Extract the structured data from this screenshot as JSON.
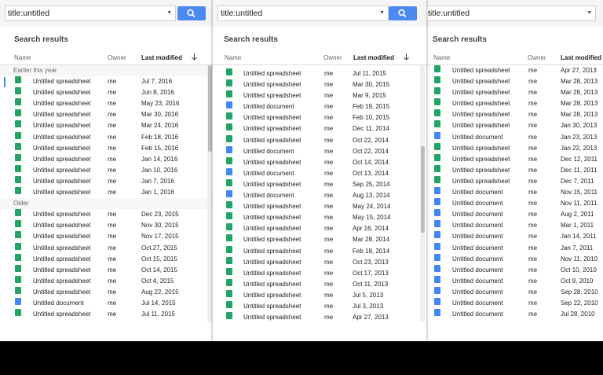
{
  "search": {
    "value": "title:untitled"
  },
  "header": {
    "title": "Search results"
  },
  "columns": {
    "name": "Name",
    "owner": "Owner",
    "modified": "Last modified"
  },
  "icons": {
    "search": "search-icon",
    "dropdown": "dropdown-arrow-icon",
    "sort": "sort-arrow-down-icon",
    "spreadsheet": "spreadsheet-icon",
    "document": "document-icon"
  },
  "colors": {
    "accent": "#4d88f0",
    "sheet": "#21a464",
    "doc": "#4285f4"
  },
  "panels": [
    {
      "sections": [
        {
          "label": "Earlier this year",
          "rows": [
            {
              "name": "Untitled spreadsheet",
              "owner": "me",
              "date": "Jul 7, 2016",
              "type": "sheet"
            },
            {
              "name": "Untitled spreadsheet",
              "owner": "me",
              "date": "Jun 8, 2016",
              "type": "sheet"
            },
            {
              "name": "Untitled spreadsheet",
              "owner": "me",
              "date": "May 23, 2016",
              "type": "sheet"
            },
            {
              "name": "Untitled spreadsheet",
              "owner": "me",
              "date": "Mar 30, 2016",
              "type": "sheet"
            },
            {
              "name": "Untitled spreadsheet",
              "owner": "me",
              "date": "Mar 24, 2016",
              "type": "sheet"
            },
            {
              "name": "Untitled spreadsheet",
              "owner": "me",
              "date": "Feb 18, 2016",
              "type": "sheet"
            },
            {
              "name": "Untitled spreadsheet",
              "owner": "me",
              "date": "Feb 15, 2016",
              "type": "sheet"
            },
            {
              "name": "Untitled spreadsheet",
              "owner": "me",
              "date": "Jan 14, 2016",
              "type": "sheet"
            },
            {
              "name": "Untitled spreadsheet",
              "owner": "me",
              "date": "Jan 10, 2016",
              "type": "sheet"
            },
            {
              "name": "Untitled spreadsheet",
              "owner": "me",
              "date": "Jan 7, 2016",
              "type": "sheet"
            },
            {
              "name": "Untitled spreadsheet",
              "owner": "me",
              "date": "Jan 1, 2016",
              "type": "sheet"
            }
          ]
        },
        {
          "label": "Older",
          "rows": [
            {
              "name": "Untitled spreadsheet",
              "owner": "me",
              "date": "Dec 23, 2015",
              "type": "sheet"
            },
            {
              "name": "Untitled spreadsheet",
              "owner": "me",
              "date": "Nov 30, 2015",
              "type": "sheet"
            },
            {
              "name": "Untitled spreadsheet",
              "owner": "me",
              "date": "Nov 17, 2015",
              "type": "sheet"
            },
            {
              "name": "Untitled spreadsheet",
              "owner": "me",
              "date": "Oct 27, 2015",
              "type": "sheet"
            },
            {
              "name": "Untitled spreadsheet",
              "owner": "me",
              "date": "Oct 15, 2015",
              "type": "sheet"
            },
            {
              "name": "Untitled spreadsheet",
              "owner": "me",
              "date": "Oct 14, 2015",
              "type": "sheet"
            },
            {
              "name": "Untitled spreadsheet",
              "owner": "me",
              "date": "Oct 4, 2015",
              "type": "sheet"
            },
            {
              "name": "Untitled spreadsheet",
              "owner": "me",
              "date": "Aug 22, 2015",
              "type": "sheet"
            },
            {
              "name": "Untitled document",
              "owner": "me",
              "date": "Jul 14, 2015",
              "type": "doc"
            },
            {
              "name": "Untitled spreadsheet",
              "owner": "me",
              "date": "Jul 11, 2015",
              "type": "sheet"
            }
          ]
        }
      ]
    },
    {
      "sections": [
        {
          "label": "",
          "rows": [
            {
              "name": "Untitled spreadsheet",
              "owner": "me",
              "date": "Jul 11, 2015",
              "type": "sheet"
            },
            {
              "name": "Untitled spreadsheet",
              "owner": "me",
              "date": "Mar 30, 2015",
              "type": "sheet"
            },
            {
              "name": "Untitled spreadsheet",
              "owner": "me",
              "date": "Mar 9, 2015",
              "type": "sheet"
            },
            {
              "name": "Untitled document",
              "owner": "me",
              "date": "Feb 19, 2015",
              "type": "doc"
            },
            {
              "name": "Untitled spreadsheet",
              "owner": "me",
              "date": "Feb 10, 2015",
              "type": "sheet"
            },
            {
              "name": "Untitled spreadsheet",
              "owner": "me",
              "date": "Dec 11, 2014",
              "type": "sheet"
            },
            {
              "name": "Untitled spreadsheet",
              "owner": "me",
              "date": "Oct 22, 2014",
              "type": "sheet"
            },
            {
              "name": "Untitled document",
              "owner": "me",
              "date": "Oct 22, 2014",
              "type": "doc"
            },
            {
              "name": "Untitled spreadsheet",
              "owner": "me",
              "date": "Oct 14, 2014",
              "type": "sheet"
            },
            {
              "name": "Untitled document",
              "owner": "me",
              "date": "Oct 13, 2014",
              "type": "doc"
            },
            {
              "name": "Untitled spreadsheet",
              "owner": "me",
              "date": "Sep 25, 2014",
              "type": "sheet"
            },
            {
              "name": "Untitled document",
              "owner": "me",
              "date": "Aug 13, 2014",
              "type": "doc"
            },
            {
              "name": "Untitled spreadsheet",
              "owner": "me",
              "date": "May 24, 2014",
              "type": "sheet"
            },
            {
              "name": "Untitled spreadsheet",
              "owner": "me",
              "date": "May 15, 2014",
              "type": "sheet"
            },
            {
              "name": "Untitled spreadsheet",
              "owner": "me",
              "date": "Apr 16, 2014",
              "type": "sheet"
            },
            {
              "name": "Untitled spreadsheet",
              "owner": "me",
              "date": "Mar 28, 2014",
              "type": "sheet"
            },
            {
              "name": "Untitled spreadsheet",
              "owner": "me",
              "date": "Feb 18, 2014",
              "type": "sheet"
            },
            {
              "name": "Untitled spreadsheet",
              "owner": "me",
              "date": "Oct 23, 2013",
              "type": "sheet"
            },
            {
              "name": "Untitled spreadsheet",
              "owner": "me",
              "date": "Oct 17, 2013",
              "type": "sheet"
            },
            {
              "name": "Untitled spreadsheet",
              "owner": "me",
              "date": "Oct 11, 2013",
              "type": "sheet"
            },
            {
              "name": "Untitled spreadsheet",
              "owner": "me",
              "date": "Jul 5, 2013",
              "type": "sheet"
            },
            {
              "name": "Untitled spreadsheet",
              "owner": "me",
              "date": "Jul 3, 2013",
              "type": "sheet"
            },
            {
              "name": "Untitled spreadsheet",
              "owner": "me",
              "date": "Apr 27, 2013",
              "type": "sheet"
            }
          ]
        }
      ]
    },
    {
      "sections": [
        {
          "label": "",
          "rows": [
            {
              "name": "Untitled spreadsheet",
              "owner": "me",
              "date": "Apr 27, 2013",
              "type": "sheet"
            },
            {
              "name": "Untitled spreadsheet",
              "owner": "me",
              "date": "Mar 28, 2013",
              "type": "sheet"
            },
            {
              "name": "Untitled spreadsheet",
              "owner": "me",
              "date": "Mar 28, 2013",
              "type": "sheet"
            },
            {
              "name": "Untitled spreadsheet",
              "owner": "me",
              "date": "Mar 28, 2013",
              "type": "sheet"
            },
            {
              "name": "Untitled spreadsheet",
              "owner": "me",
              "date": "Mar 28, 2013",
              "type": "sheet"
            },
            {
              "name": "Untitled spreadsheet",
              "owner": "me",
              "date": "Jan 30, 2013",
              "type": "sheet"
            },
            {
              "name": "Untitled document",
              "owner": "me",
              "date": "Jan 23, 2013",
              "type": "doc"
            },
            {
              "name": "Untitled spreadsheet",
              "owner": "me",
              "date": "Jan 22, 2013",
              "type": "sheet"
            },
            {
              "name": "Untitled spreadsheet",
              "owner": "me",
              "date": "Dec 12, 2011",
              "type": "sheet"
            },
            {
              "name": "Untitled spreadsheet",
              "owner": "me",
              "date": "Dec 11, 2011",
              "type": "sheet"
            },
            {
              "name": "Untitled spreadsheet",
              "owner": "me",
              "date": "Dec 7, 2011",
              "type": "sheet"
            },
            {
              "name": "Untitled document",
              "owner": "me",
              "date": "Nov 15, 2011",
              "type": "doc"
            },
            {
              "name": "Untitled document",
              "owner": "me",
              "date": "Nov 11, 2011",
              "type": "doc"
            },
            {
              "name": "Untitled document",
              "owner": "me",
              "date": "Aug 2, 2011",
              "type": "doc"
            },
            {
              "name": "Untitled document",
              "owner": "me",
              "date": "Mar 1, 2011",
              "type": "doc"
            },
            {
              "name": "Untitled document",
              "owner": "me",
              "date": "Jan 14, 2011",
              "type": "doc"
            },
            {
              "name": "Untitled document",
              "owner": "me",
              "date": "Jan 7, 2011",
              "type": "doc"
            },
            {
              "name": "Untitled document",
              "owner": "me",
              "date": "Nov 11, 2010",
              "type": "doc"
            },
            {
              "name": "Untitled document",
              "owner": "me",
              "date": "Oct 10, 2010",
              "type": "doc"
            },
            {
              "name": "Untitled document",
              "owner": "me",
              "date": "Oct 9, 2010",
              "type": "doc"
            },
            {
              "name": "Untitled document",
              "owner": "me",
              "date": "Sep 28, 2010",
              "type": "doc"
            },
            {
              "name": "Untitled document",
              "owner": "me",
              "date": "Sep 22, 2010",
              "type": "doc"
            },
            {
              "name": "Untitled document",
              "owner": "me",
              "date": "Jul 28, 2010",
              "type": "doc"
            }
          ]
        }
      ]
    }
  ]
}
